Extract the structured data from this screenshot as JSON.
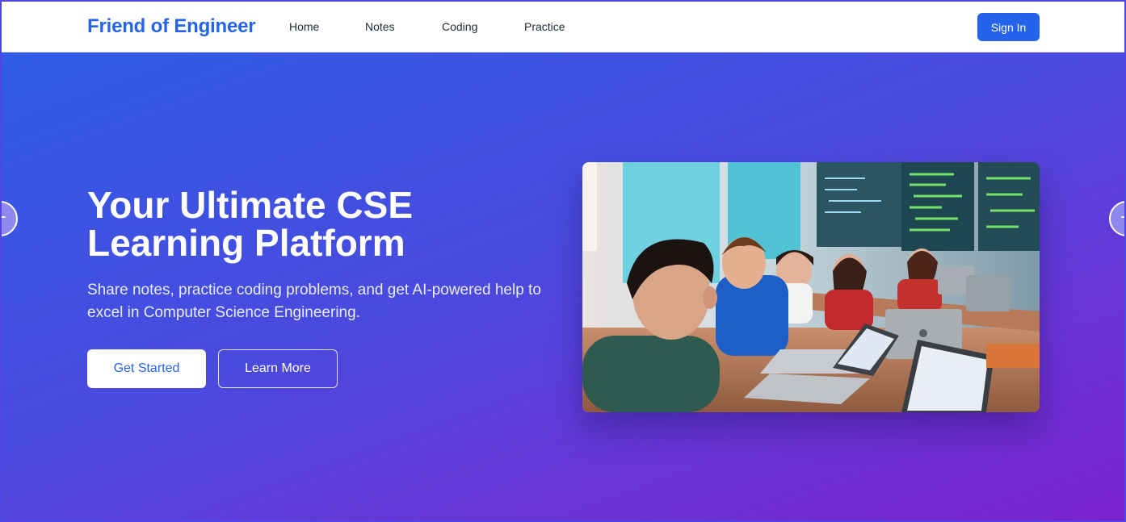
{
  "navbar": {
    "brand": "Friend of Engineer",
    "links": [
      "Home",
      "Notes",
      "Coding",
      "Practice"
    ],
    "signin_label": "Sign In"
  },
  "hero": {
    "headline": "Your Ultimate CSE Learning Platform",
    "subtext": "Share notes, practice coding problems, and get AI-powered help to excel in Computer Science Engineering.",
    "primary_button": "Get Started",
    "secondary_button": "Learn More",
    "image": "students-coding-classroom-illustration"
  },
  "carousel": {
    "prev_icon": "minus-icon",
    "next_icon": "minus-icon"
  },
  "colors": {
    "brand": "#2563eb",
    "gradient_start": "#2f5ce6",
    "gradient_end": "#7a22cc"
  }
}
